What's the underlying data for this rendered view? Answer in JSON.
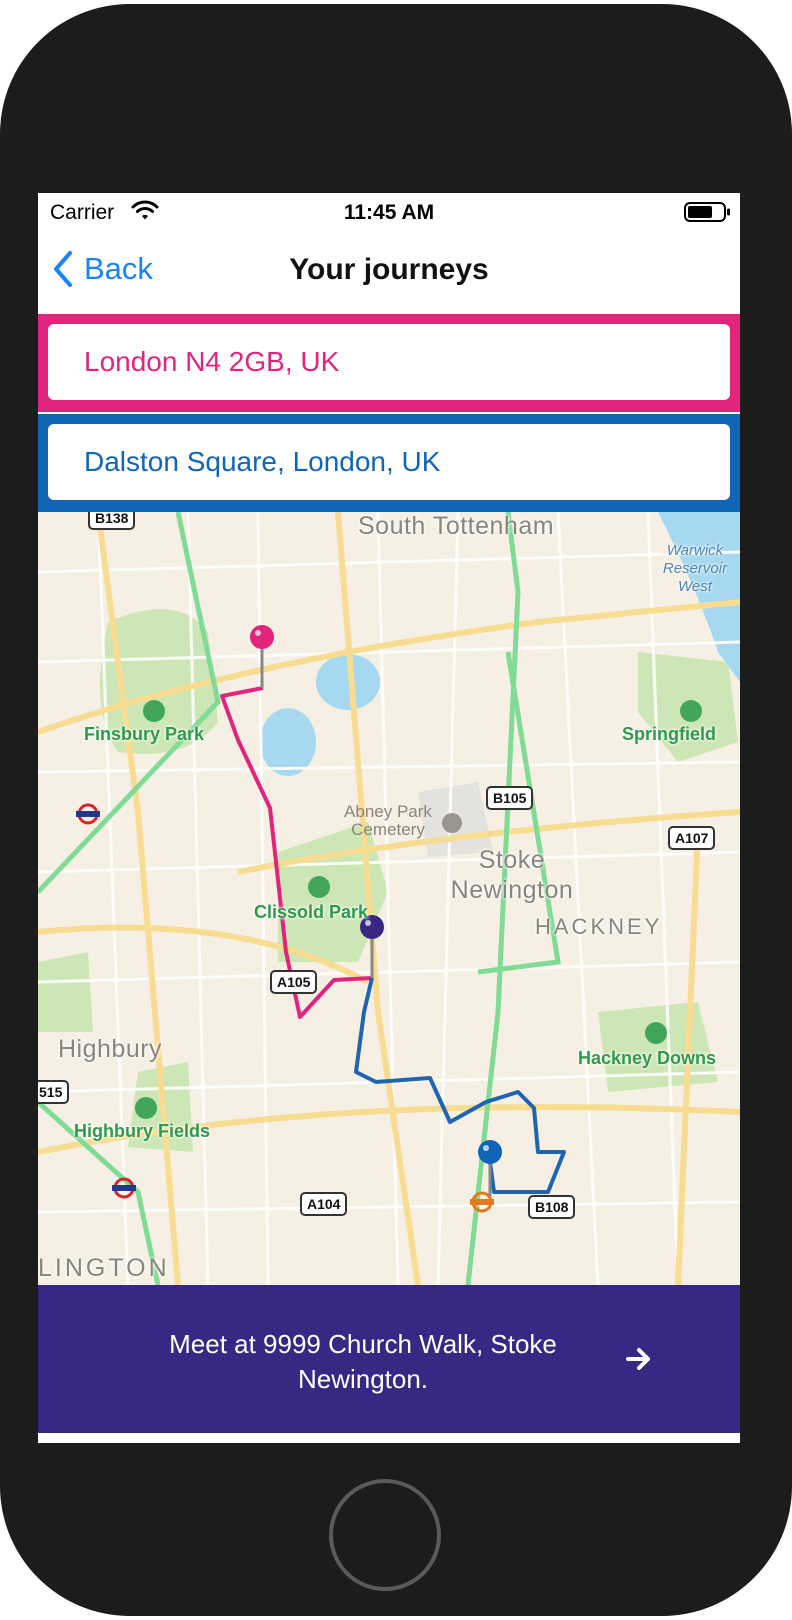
{
  "status_bar": {
    "carrier": "Carrier",
    "time": "11:45 AM"
  },
  "nav": {
    "back_label": "Back",
    "title": "Your journeys"
  },
  "journeys": {
    "origin": "London N4 2GB, UK",
    "destination": "Dalston Square, London, UK"
  },
  "map": {
    "areas": [
      "South Tottenham",
      "Stoke Newington",
      "HACKNEY",
      "Highbury",
      "LINGTON"
    ],
    "parks": [
      "Finsbury Park",
      "Clissold Park",
      "Springfield",
      "Hackney Downs",
      "Highbury Fields",
      "Warwick Reservoir West"
    ],
    "cemetery": "Abney Park Cemetery",
    "roads": [
      "B138",
      "B105",
      "A107",
      "A105",
      "515",
      "A104",
      "B108"
    ],
    "pins": {
      "origin_color": "#e3247c",
      "meeting_color": "#382783",
      "destination_color": "#1264b4"
    },
    "route_colors": {
      "origin": "#e3247c",
      "destination": "#1f64b0"
    }
  },
  "meet": {
    "text": "Meet at 9999 Church Walk, Stoke Newington.",
    "icon": "arrow-right-icon"
  },
  "colors": {
    "accent_pink": "#e3247c",
    "accent_blue": "#1264b4",
    "footer": "#382783",
    "link": "#1a84f5"
  }
}
